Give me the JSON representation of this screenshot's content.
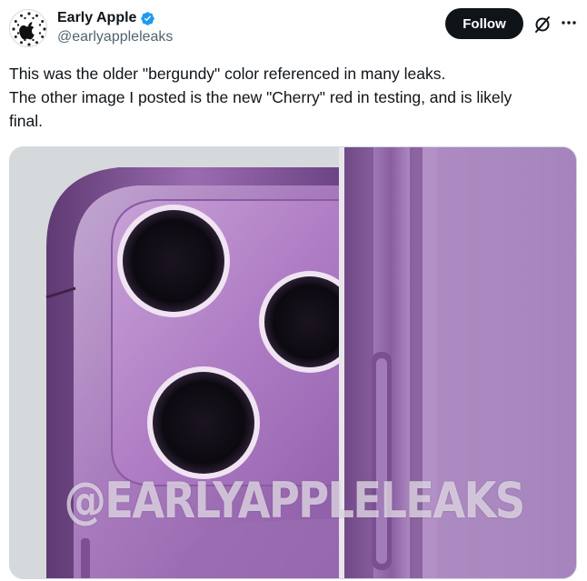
{
  "author": {
    "display_name": "Early Apple",
    "handle": "@earlyappleleaks",
    "verified": true,
    "avatar_icon": "apple-logo-icon"
  },
  "actions": {
    "follow_label": "Follow",
    "grok_icon": "grok-icon",
    "more_icon": "more-dots-icon"
  },
  "tweet": {
    "line1": "This was the older \"bergundy\" color referenced in many leaks.",
    "line2": "The other image I posted is the new \"Cherry\" red in testing, and is likely",
    "line3": "final."
  },
  "media": {
    "watermark": "@EARLYAPPLELEAKS"
  },
  "colors": {
    "accent": "#1d9bf0",
    "follow_bg": "#0f1419",
    "text_secondary": "#536471",
    "border": "#cfd9de"
  }
}
